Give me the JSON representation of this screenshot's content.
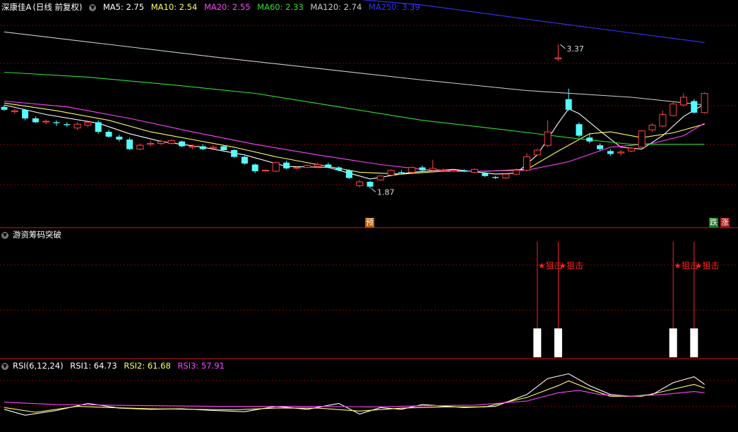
{
  "header": {
    "stock_name": "深康佳A",
    "period_label": "(日线 前复权)",
    "ma_items": [
      {
        "label": "MA5: 2.75",
        "color": "#ffffff"
      },
      {
        "label": "MA10: 2.54",
        "color": "#ffff66"
      },
      {
        "label": "MA20: 2.55",
        "color": "#ff44ff"
      },
      {
        "label": "MA60: 2.33",
        "color": "#33dd33"
      },
      {
        "label": "MA120: 2.74",
        "color": "#cccccc"
      },
      {
        "label": "MA250: 3.39",
        "color": "#3333ff"
      }
    ]
  },
  "indicator_panel": {
    "title": "游资筹码突破",
    "signal_label": "★狙击"
  },
  "rsi_panel": {
    "title": "RSI(6,12,24)",
    "items": [
      {
        "label": "RSI1: 64.73",
        "color": "#ffffff"
      },
      {
        "label": "RSI2: 61.68",
        "color": "#ffff66"
      },
      {
        "label": "RSI3: 57.91",
        "color": "#ff44ff"
      }
    ]
  },
  "markers": {
    "pre_label": "预",
    "fall_label": "跌",
    "rise_label": "涨"
  },
  "colors": {
    "up": "#ff4444",
    "down": "#54ffff",
    "grid": "#8b0000",
    "signal": "#ff2020",
    "bar": "#ffffff"
  },
  "chart_data": {
    "type": "candlestick",
    "price_ylim": [
      1.5,
      3.7
    ],
    "price_annotations": {
      "high": "3.37",
      "low": "1.87"
    },
    "candles": [
      {
        "o": 2.72,
        "h": 2.74,
        "l": 2.68,
        "c": 2.69
      },
      {
        "o": 2.67,
        "h": 2.7,
        "l": 2.65,
        "c": 2.68
      },
      {
        "o": 2.69,
        "h": 2.7,
        "l": 2.58,
        "c": 2.6
      },
      {
        "o": 2.6,
        "h": 2.62,
        "l": 2.55,
        "c": 2.56
      },
      {
        "o": 2.57,
        "h": 2.59,
        "l": 2.54,
        "c": 2.57
      },
      {
        "o": 2.56,
        "h": 2.58,
        "l": 2.52,
        "c": 2.55
      },
      {
        "o": 2.54,
        "h": 2.56,
        "l": 2.51,
        "c": 2.53
      },
      {
        "o": 2.5,
        "h": 2.56,
        "l": 2.48,
        "c": 2.54
      },
      {
        "o": 2.53,
        "h": 2.58,
        "l": 2.51,
        "c": 2.56
      },
      {
        "o": 2.56,
        "h": 2.58,
        "l": 2.44,
        "c": 2.46
      },
      {
        "o": 2.46,
        "h": 2.48,
        "l": 2.4,
        "c": 2.41
      },
      {
        "o": 2.41,
        "h": 2.43,
        "l": 2.36,
        "c": 2.38
      },
      {
        "o": 2.38,
        "h": 2.4,
        "l": 2.27,
        "c": 2.28
      },
      {
        "o": 2.28,
        "h": 2.34,
        "l": 2.27,
        "c": 2.32
      },
      {
        "o": 2.33,
        "h": 2.37,
        "l": 2.31,
        "c": 2.34
      },
      {
        "o": 2.34,
        "h": 2.38,
        "l": 2.32,
        "c": 2.36
      },
      {
        "o": 2.34,
        "h": 2.38,
        "l": 2.33,
        "c": 2.37
      },
      {
        "o": 2.36,
        "h": 2.37,
        "l": 2.3,
        "c": 2.31
      },
      {
        "o": 2.3,
        "h": 2.33,
        "l": 2.28,
        "c": 2.31
      },
      {
        "o": 2.31,
        "h": 2.33,
        "l": 2.27,
        "c": 2.28
      },
      {
        "o": 2.29,
        "h": 2.32,
        "l": 2.27,
        "c": 2.3
      },
      {
        "o": 2.31,
        "h": 2.32,
        "l": 2.26,
        "c": 2.27
      },
      {
        "o": 2.27,
        "h": 2.28,
        "l": 2.19,
        "c": 2.2
      },
      {
        "o": 2.2,
        "h": 2.21,
        "l": 2.12,
        "c": 2.13
      },
      {
        "o": 2.12,
        "h": 2.13,
        "l": 2.03,
        "c": 2.05
      },
      {
        "o": 2.06,
        "h": 2.07,
        "l": 2.05,
        "c": 2.06
      },
      {
        "o": 2.05,
        "h": 2.15,
        "l": 2.04,
        "c": 2.14
      },
      {
        "o": 2.14,
        "h": 2.16,
        "l": 2.07,
        "c": 2.08
      },
      {
        "o": 2.08,
        "h": 2.1,
        "l": 2.07,
        "c": 2.09
      },
      {
        "o": 2.09,
        "h": 2.12,
        "l": 2.08,
        "c": 2.11
      },
      {
        "o": 2.1,
        "h": 2.14,
        "l": 2.09,
        "c": 2.12
      },
      {
        "o": 2.12,
        "h": 2.14,
        "l": 2.08,
        "c": 2.09
      },
      {
        "o": 2.09,
        "h": 2.1,
        "l": 2.05,
        "c": 2.06
      },
      {
        "o": 2.06,
        "h": 2.07,
        "l": 1.97,
        "c": 1.98
      },
      {
        "o": 1.9,
        "h": 1.96,
        "l": 1.88,
        "c": 1.94
      },
      {
        "o": 1.94,
        "h": 1.95,
        "l": 1.87,
        "c": 1.89
      },
      {
        "o": 1.96,
        "h": 2.01,
        "l": 1.95,
        "c": 2.0
      },
      {
        "o": 2.01,
        "h": 2.07,
        "l": 2.0,
        "c": 2.06
      },
      {
        "o": 2.04,
        "h": 2.06,
        "l": 2.02,
        "c": 2.03
      },
      {
        "o": 2.04,
        "h": 2.1,
        "l": 2.03,
        "c": 2.09
      },
      {
        "o": 2.09,
        "h": 2.11,
        "l": 2.05,
        "c": 2.06
      },
      {
        "o": 2.06,
        "h": 2.17,
        "l": 2.05,
        "c": 2.08
      },
      {
        "o": 2.06,
        "h": 2.08,
        "l": 2.04,
        "c": 2.06
      },
      {
        "o": 2.05,
        "h": 2.07,
        "l": 2.04,
        "c": 2.06
      },
      {
        "o": 2.06,
        "h": 2.07,
        "l": 2.04,
        "c": 2.05
      },
      {
        "o": 2.04,
        "h": 2.08,
        "l": 2.03,
        "c": 2.07
      },
      {
        "o": 2.03,
        "h": 2.04,
        "l": 1.99,
        "c": 2.0
      },
      {
        "o": 1.99,
        "h": 2.0,
        "l": 1.97,
        "c": 1.98
      },
      {
        "o": 1.98,
        "h": 2.03,
        "l": 1.97,
        "c": 2.02
      },
      {
        "o": 2.02,
        "h": 2.08,
        "l": 2.01,
        "c": 2.06
      },
      {
        "o": 2.06,
        "h": 2.24,
        "l": 2.05,
        "c": 2.2
      },
      {
        "o": 2.22,
        "h": 2.28,
        "l": 2.21,
        "c": 2.27
      },
      {
        "o": 2.32,
        "h": 2.58,
        "l": 2.3,
        "c": 2.46
      },
      {
        "o": 3.22,
        "h": 3.37,
        "l": 3.2,
        "c": 3.23
      },
      {
        "o": 2.8,
        "h": 2.91,
        "l": 2.68,
        "c": 2.69
      },
      {
        "o": 2.54,
        "h": 2.56,
        "l": 2.4,
        "c": 2.42
      },
      {
        "o": 2.4,
        "h": 2.44,
        "l": 2.34,
        "c": 2.36
      },
      {
        "o": 2.32,
        "h": 2.34,
        "l": 2.26,
        "c": 2.28
      },
      {
        "o": 2.26,
        "h": 2.28,
        "l": 2.21,
        "c": 2.23
      },
      {
        "o": 2.24,
        "h": 2.27,
        "l": 2.21,
        "c": 2.25
      },
      {
        "o": 2.26,
        "h": 2.3,
        "l": 2.25,
        "c": 2.29
      },
      {
        "o": 2.3,
        "h": 2.48,
        "l": 2.29,
        "c": 2.47
      },
      {
        "o": 2.48,
        "h": 2.55,
        "l": 2.46,
        "c": 2.53
      },
      {
        "o": 2.52,
        "h": 2.68,
        "l": 2.51,
        "c": 2.64
      },
      {
        "o": 2.63,
        "h": 2.77,
        "l": 2.62,
        "c": 2.75
      },
      {
        "o": 2.74,
        "h": 2.86,
        "l": 2.72,
        "c": 2.82
      },
      {
        "o": 2.78,
        "h": 2.8,
        "l": 2.65,
        "c": 2.66
      },
      {
        "o": 2.66,
        "h": 2.87,
        "l": 2.65,
        "c": 2.86
      }
    ],
    "ma_lines": [
      {
        "name": "MA5",
        "color": "#ffffff",
        "values": [
          [
            0,
            2.74
          ],
          [
            4,
            2.64
          ],
          [
            9,
            2.55
          ],
          [
            12,
            2.44
          ],
          [
            15,
            2.36
          ],
          [
            19,
            2.3
          ],
          [
            23,
            2.22
          ],
          [
            27,
            2.1
          ],
          [
            31,
            2.09
          ],
          [
            35,
            1.97
          ],
          [
            39,
            2.04
          ],
          [
            43,
            2.07
          ],
          [
            47,
            2.02
          ],
          [
            49,
            2.03
          ],
          [
            51,
            2.22
          ],
          [
            53,
            2.55
          ],
          [
            54,
            2.7
          ],
          [
            55,
            2.65
          ],
          [
            57,
            2.47
          ],
          [
            59,
            2.3
          ],
          [
            61,
            2.28
          ],
          [
            63,
            2.42
          ],
          [
            65,
            2.62
          ],
          [
            67,
            2.75
          ]
        ]
      },
      {
        "name": "MA10",
        "color": "#ffff66",
        "values": [
          [
            0,
            2.76
          ],
          [
            5,
            2.68
          ],
          [
            10,
            2.58
          ],
          [
            14,
            2.46
          ],
          [
            18,
            2.38
          ],
          [
            22,
            2.3
          ],
          [
            26,
            2.2
          ],
          [
            30,
            2.12
          ],
          [
            34,
            2.04
          ],
          [
            38,
            2.02
          ],
          [
            42,
            2.05
          ],
          [
            46,
            2.05
          ],
          [
            50,
            2.07
          ],
          [
            53,
            2.26
          ],
          [
            56,
            2.44
          ],
          [
            58,
            2.46
          ],
          [
            61,
            2.4
          ],
          [
            64,
            2.45
          ],
          [
            67,
            2.54
          ]
        ]
      },
      {
        "name": "MA20",
        "color": "#ff44ff",
        "values": [
          [
            0,
            2.78
          ],
          [
            6,
            2.72
          ],
          [
            12,
            2.6
          ],
          [
            18,
            2.46
          ],
          [
            24,
            2.33
          ],
          [
            30,
            2.22
          ],
          [
            36,
            2.12
          ],
          [
            40,
            2.07
          ],
          [
            45,
            2.05
          ],
          [
            50,
            2.06
          ],
          [
            54,
            2.15
          ],
          [
            58,
            2.3
          ],
          [
            62,
            2.34
          ],
          [
            65,
            2.42
          ],
          [
            67,
            2.55
          ]
        ]
      },
      {
        "name": "MA60",
        "color": "#33dd33",
        "values": [
          [
            0,
            3.08
          ],
          [
            8,
            3.03
          ],
          [
            16,
            2.95
          ],
          [
            24,
            2.86
          ],
          [
            32,
            2.72
          ],
          [
            40,
            2.58
          ],
          [
            48,
            2.48
          ],
          [
            54,
            2.4
          ],
          [
            60,
            2.33
          ],
          [
            67,
            2.33
          ]
        ]
      },
      {
        "name": "MA120",
        "color": "#cccccc",
        "values": [
          [
            0,
            3.5
          ],
          [
            10,
            3.37
          ],
          [
            20,
            3.24
          ],
          [
            30,
            3.12
          ],
          [
            40,
            3.0
          ],
          [
            50,
            2.89
          ],
          [
            60,
            2.82
          ],
          [
            67,
            2.74
          ]
        ]
      },
      {
        "name": "MA250",
        "color": "#3333ff",
        "values": [
          [
            0,
            4.15
          ],
          [
            20,
            3.97
          ],
          [
            40,
            3.78
          ],
          [
            55,
            3.56
          ],
          [
            67,
            3.39
          ]
        ]
      }
    ],
    "signal_indices": [
      51,
      53,
      64,
      66
    ],
    "rsi_ylim": [
      0,
      100
    ],
    "rsi_lines": [
      {
        "name": "RSI1",
        "color": "#ffffff",
        "values": [
          [
            0,
            30
          ],
          [
            2,
            20
          ],
          [
            5,
            28
          ],
          [
            8,
            40
          ],
          [
            11,
            32
          ],
          [
            14,
            30
          ],
          [
            17,
            31
          ],
          [
            20,
            28
          ],
          [
            23,
            26
          ],
          [
            26,
            35
          ],
          [
            29,
            30
          ],
          [
            32,
            40
          ],
          [
            34,
            22
          ],
          [
            36,
            33
          ],
          [
            38,
            30
          ],
          [
            40,
            38
          ],
          [
            44,
            33
          ],
          [
            47,
            35
          ],
          [
            50,
            55
          ],
          [
            52,
            82
          ],
          [
            54,
            90
          ],
          [
            56,
            70
          ],
          [
            58,
            55
          ],
          [
            60,
            52
          ],
          [
            62,
            55
          ],
          [
            64,
            75
          ],
          [
            66,
            85
          ],
          [
            67,
            72
          ]
        ]
      },
      {
        "name": "RSI2",
        "color": "#ffff66",
        "values": [
          [
            0,
            33
          ],
          [
            3,
            25
          ],
          [
            7,
            35
          ],
          [
            10,
            33
          ],
          [
            14,
            31
          ],
          [
            18,
            30
          ],
          [
            22,
            29
          ],
          [
            26,
            32
          ],
          [
            30,
            32
          ],
          [
            34,
            27
          ],
          [
            38,
            32
          ],
          [
            42,
            34
          ],
          [
            46,
            34
          ],
          [
            50,
            50
          ],
          [
            53,
            70
          ],
          [
            54,
            78
          ],
          [
            56,
            64
          ],
          [
            58,
            52
          ],
          [
            61,
            52
          ],
          [
            63,
            60
          ],
          [
            66,
            72
          ],
          [
            67,
            66
          ]
        ]
      },
      {
        "name": "RSI3",
        "color": "#ff44ff",
        "values": [
          [
            0,
            42
          ],
          [
            5,
            38
          ],
          [
            10,
            37
          ],
          [
            15,
            36
          ],
          [
            20,
            35
          ],
          [
            25,
            35
          ],
          [
            30,
            35
          ],
          [
            35,
            34
          ],
          [
            40,
            36
          ],
          [
            45,
            37
          ],
          [
            50,
            44
          ],
          [
            53,
            58
          ],
          [
            55,
            62
          ],
          [
            57,
            55
          ],
          [
            60,
            52
          ],
          [
            63,
            55
          ],
          [
            66,
            60
          ],
          [
            67,
            58
          ]
        ]
      }
    ]
  }
}
